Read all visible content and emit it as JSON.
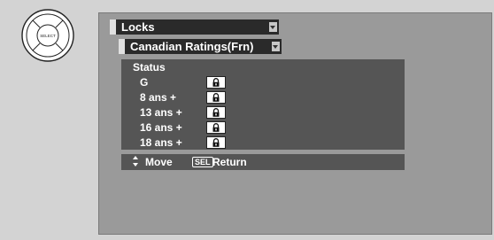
{
  "remote": {
    "center_label": "SELECT"
  },
  "menus": {
    "locks": "Locks",
    "ratings": "Canadian Ratings(Frn)"
  },
  "panel": {
    "status_label": "Status",
    "rows": [
      {
        "name": "G",
        "lock_icon": "lock-icon"
      },
      {
        "name": "8 ans +",
        "lock_icon": "lock-icon"
      },
      {
        "name": "13 ans +",
        "lock_icon": "lock-icon"
      },
      {
        "name": "16 ans +",
        "lock_icon": "lock-icon"
      },
      {
        "name": "18 ans +",
        "lock_icon": "lock-icon"
      }
    ]
  },
  "footer": {
    "move_label": "Move",
    "sel_badge": "SEL",
    "return_label": "Return"
  },
  "colors": {
    "background": "#d3d3d3",
    "screen": "#9a9a9a",
    "menu_bar": "#2a2a2a",
    "panel": "#555555",
    "text": "#ffffff"
  }
}
